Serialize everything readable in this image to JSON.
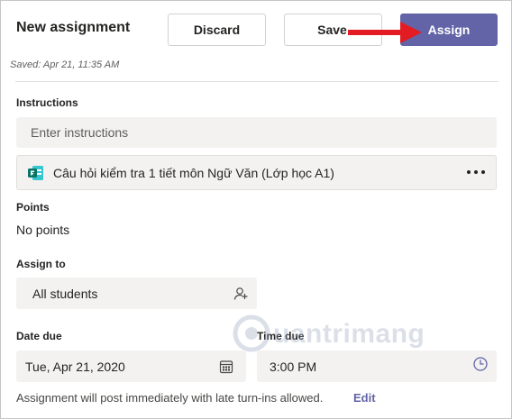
{
  "header": {
    "title": "New assignment",
    "saved_text": "Saved: Apr 21, 11:35 AM",
    "discard_label": "Discard",
    "save_label": "Save",
    "assign_label": "Assign"
  },
  "instructions": {
    "label": "Instructions",
    "placeholder": "Enter instructions"
  },
  "attachment": {
    "name": "Câu hỏi kiểm tra 1 tiết môn Ngữ Văn (Lớp học A1)",
    "icon": "forms-icon"
  },
  "points": {
    "label": "Points",
    "value": "No points"
  },
  "assign_to": {
    "label": "Assign to",
    "value": "All students",
    "icon": "add-person-icon"
  },
  "date_due": {
    "label": "Date due",
    "value": "Tue, Apr 21, 2020",
    "icon": "calendar-icon"
  },
  "time_due": {
    "label": "Time due",
    "value": "3:00 PM",
    "icon": "clock-icon"
  },
  "footer": {
    "text": "Assignment will post immediately with late turn-ins allowed.",
    "edit_label": "Edit"
  },
  "watermark": {
    "text": "uantrimang"
  },
  "colors": {
    "accent": "#6264a7",
    "arrow": "#e31b23"
  }
}
